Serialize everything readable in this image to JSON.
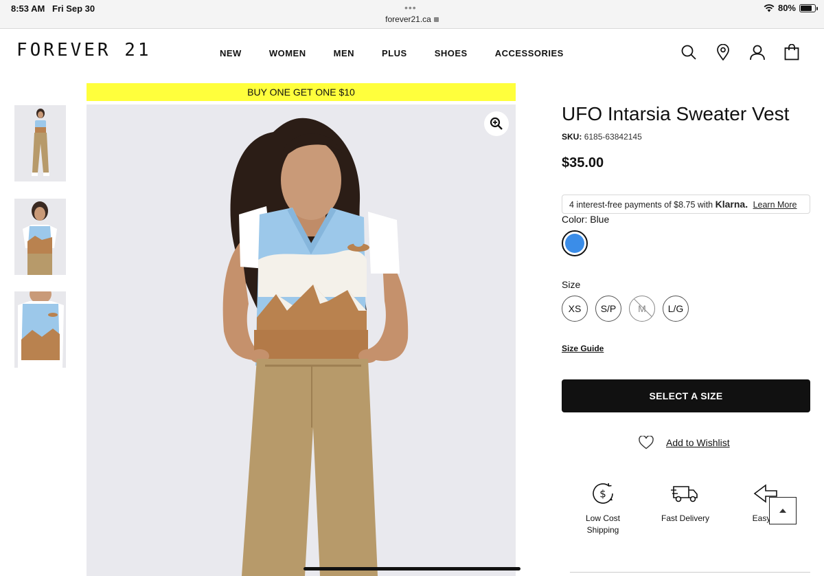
{
  "status_bar": {
    "time": "8:53 AM",
    "date": "Fri Sep 30",
    "url": "forever21.ca",
    "battery": "80%"
  },
  "header": {
    "logo": "FOREVER 21",
    "nav": [
      "NEW",
      "WOMEN",
      "MEN",
      "PLUS",
      "SHOES",
      "ACCESSORIES"
    ],
    "icons": [
      "search-icon",
      "location-pin-icon",
      "account-icon",
      "shopping-bag-icon"
    ]
  },
  "promo_banner": "BUY ONE GET ONE $10",
  "product": {
    "title": "UFO Intarsia Sweater Vest",
    "sku_label": "SKU:",
    "sku": "6185-63842145",
    "price": "$35.00",
    "klarna": {
      "text": "4 interest-free payments of $8.75 with",
      "brand": "Klarna.",
      "link": "Learn More"
    },
    "color_label": "Color: Blue",
    "color_swatch": "#3b8de8",
    "size_label": "Size",
    "sizes": [
      {
        "label": "XS",
        "available": true
      },
      {
        "label": "S/P",
        "available": true
      },
      {
        "label": "M",
        "available": false
      },
      {
        "label": "L/G",
        "available": true
      }
    ],
    "size_guide": "Size Guide",
    "cta": "SELECT A SIZE",
    "wishlist": "Add to Wishlist"
  },
  "perks": [
    {
      "label_line1": "Low Cost",
      "label_line2": "Shipping",
      "icon": "dollar-shipping-icon"
    },
    {
      "label_line1": "Fast Delivery",
      "label_line2": "",
      "icon": "truck-icon"
    },
    {
      "label_line1": "Easy R",
      "label_line2": "",
      "icon": "returns-icon"
    }
  ],
  "colors": {
    "promo_yellow": "#ffff3c",
    "cta_black": "#111111",
    "vest_blue": "#9cc8ea",
    "vest_tan": "#b9824f",
    "pants": "#b79a6a"
  }
}
